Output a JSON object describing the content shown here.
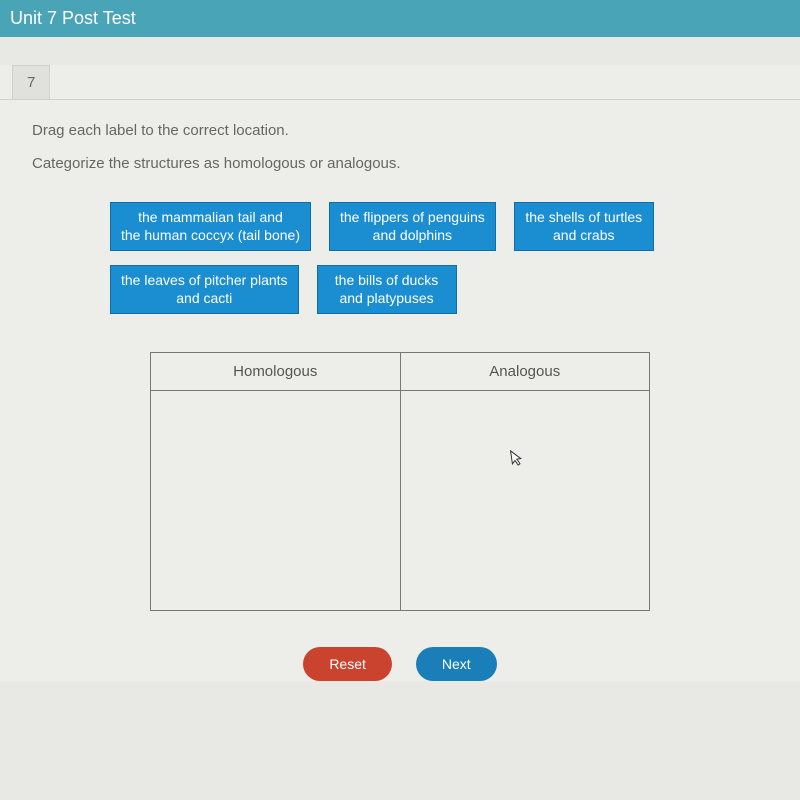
{
  "header": {
    "title": "Unit 7 Post Test"
  },
  "question": {
    "number": "7",
    "instruction": "Drag each label to the correct location.",
    "prompt": "Categorize the structures as homologous or analogous."
  },
  "labels": [
    "the mammalian tail and\nthe human coccyx (tail bone)",
    "the flippers of penguins\nand dolphins",
    "the shells of turtles\nand crabs",
    "the leaves of pitcher plants\nand cacti",
    "the bills of ducks\nand platypuses"
  ],
  "table": {
    "col1": "Homologous",
    "col2": "Analogous"
  },
  "buttons": {
    "reset": "Reset",
    "next": "Next"
  }
}
